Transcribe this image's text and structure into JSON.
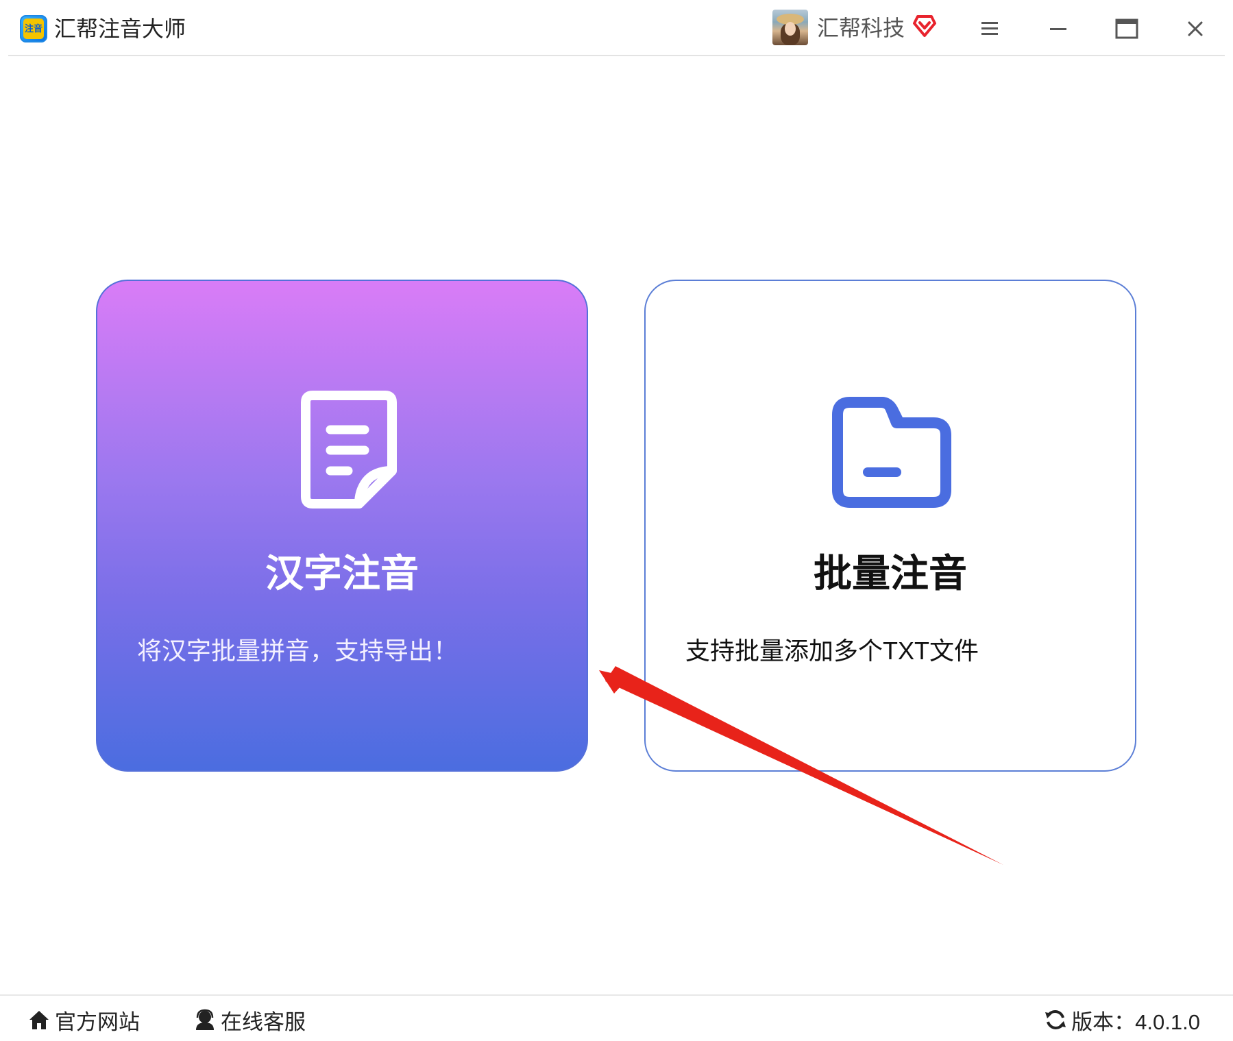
{
  "app": {
    "title": "汇帮注音大师",
    "logo_text": "注音"
  },
  "user": {
    "name": "汇帮科技"
  },
  "cards": [
    {
      "title": "汉字注音",
      "description": "将汉字批量拼音，支持导出！"
    },
    {
      "title": "批量注音",
      "description": "支持批量添加多个TXT文件"
    }
  ],
  "footer": {
    "website": "官方网站",
    "service": "在线客服",
    "version": "版本：4.0.1.0"
  },
  "colors": {
    "accent": "#4a6de0",
    "gradient_top": "#d97cf7",
    "gradient_bottom": "#4b6de0",
    "arrow": "#e8231a",
    "vip": "#e8232d"
  }
}
